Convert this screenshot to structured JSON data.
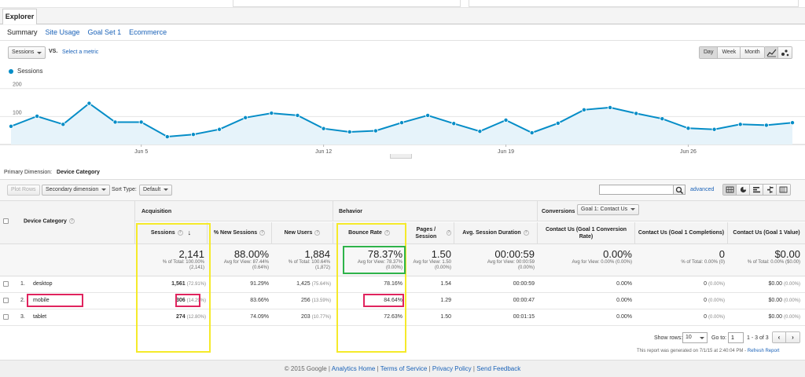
{
  "tabs": {
    "explorer": "Explorer"
  },
  "subtabs": [
    "Summary",
    "Site Usage",
    "Goal Set 1",
    "Ecommerce"
  ],
  "metric": {
    "selected": "Sessions",
    "vs": "VS.",
    "select_metric": "Select a metric"
  },
  "timescale": [
    "Day",
    "Week",
    "Month"
  ],
  "legend": {
    "series": "Sessions"
  },
  "colors": {
    "series": "#058dc7",
    "link": "#1a62b8",
    "highlight_yellow": "#f5ea2a",
    "highlight_green": "#2eb34a",
    "highlight_red": "#e0245e"
  },
  "chart_data": {
    "type": "line",
    "series": [
      {
        "name": "Sessions",
        "values": [
          65,
          101,
          72,
          147,
          80,
          80,
          28,
          36,
          54,
          96,
          112,
          104,
          57,
          45,
          49,
          78,
          104,
          75,
          47,
          87,
          42,
          76,
          124,
          132,
          111,
          92,
          58,
          54,
          72,
          69,
          78
        ]
      }
    ],
    "x_tick_labels": [
      {
        "label": "Jun 5",
        "index": 5
      },
      {
        "label": "Jun 12",
        "index": 12
      },
      {
        "label": "Jun 19",
        "index": 19
      },
      {
        "label": "Jun 26",
        "index": 26
      }
    ],
    "y_ticks": [
      "200",
      "100"
    ],
    "ylim": [
      0,
      230
    ]
  },
  "primary_dimension": {
    "label": "Primary Dimension:",
    "value": "Device Category"
  },
  "controls": {
    "plot_rows": "Plot Rows",
    "secondary_dimension": "Secondary dimension",
    "sort_type_label": "Sort Type:",
    "sort_type": "Default",
    "advanced": "advanced"
  },
  "table": {
    "groups": {
      "acquisition": "Acquisition",
      "behavior": "Behavior",
      "conversions": "Conversions",
      "goal_select": "Goal 1: Contact Us"
    },
    "dimension_header": "Device Category",
    "headers": {
      "sessions": "Sessions",
      "new_sessions": "% New Sessions",
      "new_users": "New Users",
      "bounce_rate": "Bounce Rate",
      "pages_session": "Pages / Session",
      "avg_duration": "Avg. Session Duration",
      "conv_rate": "Contact Us (Goal 1 Conversion Rate)",
      "completions": "Contact Us (Goal 1 Completions)",
      "goal_value": "Contact Us (Goal 1 Value)"
    },
    "totals": {
      "sessions": {
        "big": "2,141",
        "sub1": "% of Total: 100.00%",
        "sub2": "(2,141)"
      },
      "new_sessions": {
        "big": "88.00%",
        "sub1": "Avg for View: 87.44%",
        "sub2": "(0.64%)"
      },
      "new_users": {
        "big": "1,884",
        "sub1": "% of Total: 100.64%",
        "sub2": "(1,872)"
      },
      "bounce_rate": {
        "big": "78.37%",
        "sub1": "Avg for View: 78.37%",
        "sub2": "(0.00%)"
      },
      "pages_session": {
        "big": "1.50",
        "sub1": "Avg for View: 1.50",
        "sub2": "(0.00%)"
      },
      "avg_duration": {
        "big": "00:00:59",
        "sub1": "Avg for View: 00:00:59",
        "sub2": "(0.00%)"
      },
      "conv_rate": {
        "big": "0.00%",
        "sub1": "Avg for View: 0.00% (0.00%)"
      },
      "completions": {
        "big": "0",
        "sub1": "% of Total: 0.00% (0)"
      },
      "goal_value": {
        "big": "$0.00",
        "sub1": "% of Total: 0.00% ($0.00)"
      }
    },
    "rows": [
      {
        "num": "1.",
        "device": "desktop",
        "sessions": "1,561",
        "sessions_pct": "(72.91%)",
        "new_sessions": "91.29%",
        "new_users": "1,425",
        "new_users_pct": "(75.64%)",
        "bounce_rate": "78.16%",
        "pages_session": "1.54",
        "avg_duration": "00:00:59",
        "conv_rate": "0.00%",
        "completions": "0",
        "completions_pct": "(0.00%)",
        "goal_value": "$0.00",
        "goal_value_pct": "(0.00%)"
      },
      {
        "num": "2.",
        "device": "mobile",
        "sessions": "306",
        "sessions_pct": "(14.29%)",
        "new_sessions": "83.66%",
        "new_users": "256",
        "new_users_pct": "(13.59%)",
        "bounce_rate": "84.64%",
        "pages_session": "1.29",
        "avg_duration": "00:00:47",
        "conv_rate": "0.00%",
        "completions": "0",
        "completions_pct": "(0.00%)",
        "goal_value": "$0.00",
        "goal_value_pct": "(0.00%)"
      },
      {
        "num": "3.",
        "device": "tablet",
        "sessions": "274",
        "sessions_pct": "(12.80%)",
        "new_sessions": "74.09%",
        "new_users": "203",
        "new_users_pct": "(10.77%)",
        "bounce_rate": "72.63%",
        "pages_session": "1.50",
        "avg_duration": "00:01:15",
        "conv_rate": "0.00%",
        "completions": "0",
        "completions_pct": "(0.00%)",
        "goal_value": "$0.00",
        "goal_value_pct": "(0.00%)"
      }
    ]
  },
  "pager": {
    "show_rows": "Show rows:",
    "rows_value": "10",
    "go_to": "Go to:",
    "page": "1",
    "range": "1 - 3 of 3",
    "prev": "‹",
    "next": "›"
  },
  "generated": {
    "text": "This report was generated on 7/1/15 at 2:40:04 PM -",
    "refresh": "Refresh Report"
  },
  "footer": {
    "copyright": "© 2015 Google |",
    "home": "Analytics Home",
    "tos": "Terms of Service",
    "privacy": "Privacy Policy",
    "feedback": "Send Feedback",
    "sep": "|"
  }
}
